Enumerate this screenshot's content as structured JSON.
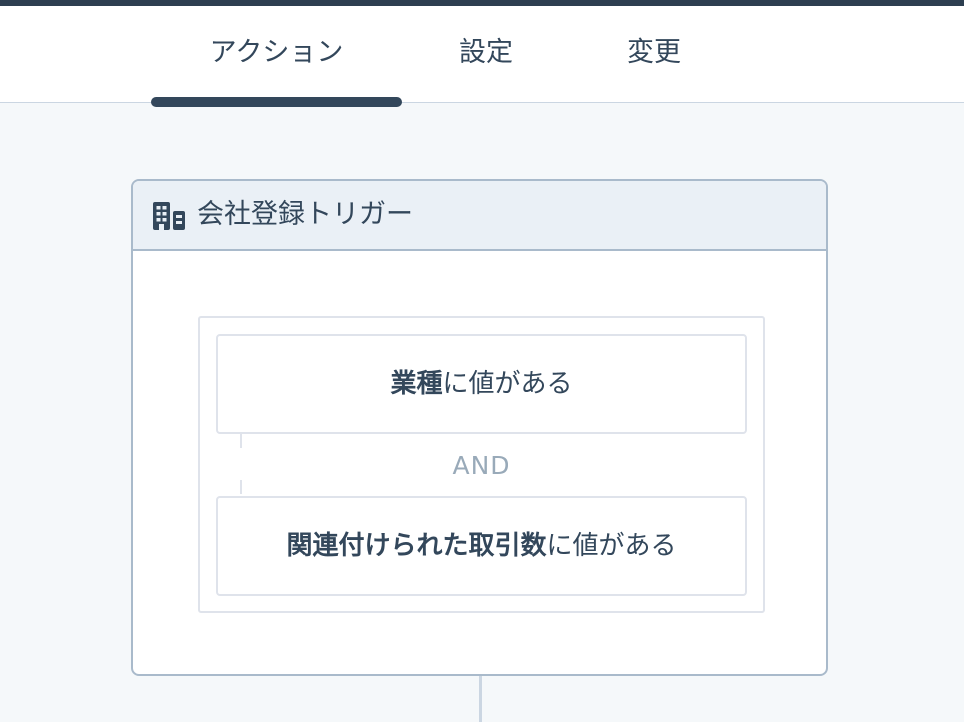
{
  "tabs": [
    {
      "label": "アクション",
      "active": true
    },
    {
      "label": "設定",
      "active": false
    },
    {
      "label": "変更",
      "active": false
    }
  ],
  "trigger_card": {
    "icon": "company-icon",
    "title": "会社登録トリガー",
    "conditions": [
      {
        "property": "業種",
        "operator_text": "に値がある"
      },
      {
        "property": "関連付けられた取引数",
        "operator_text": "に値がある"
      }
    ],
    "join_operator": "AND"
  },
  "colors": {
    "topbar": "#2d3e50",
    "text": "#33475b",
    "header_bg": "#eaf0f6",
    "card_border": "#a9bacb",
    "muted": "#99aab9"
  }
}
